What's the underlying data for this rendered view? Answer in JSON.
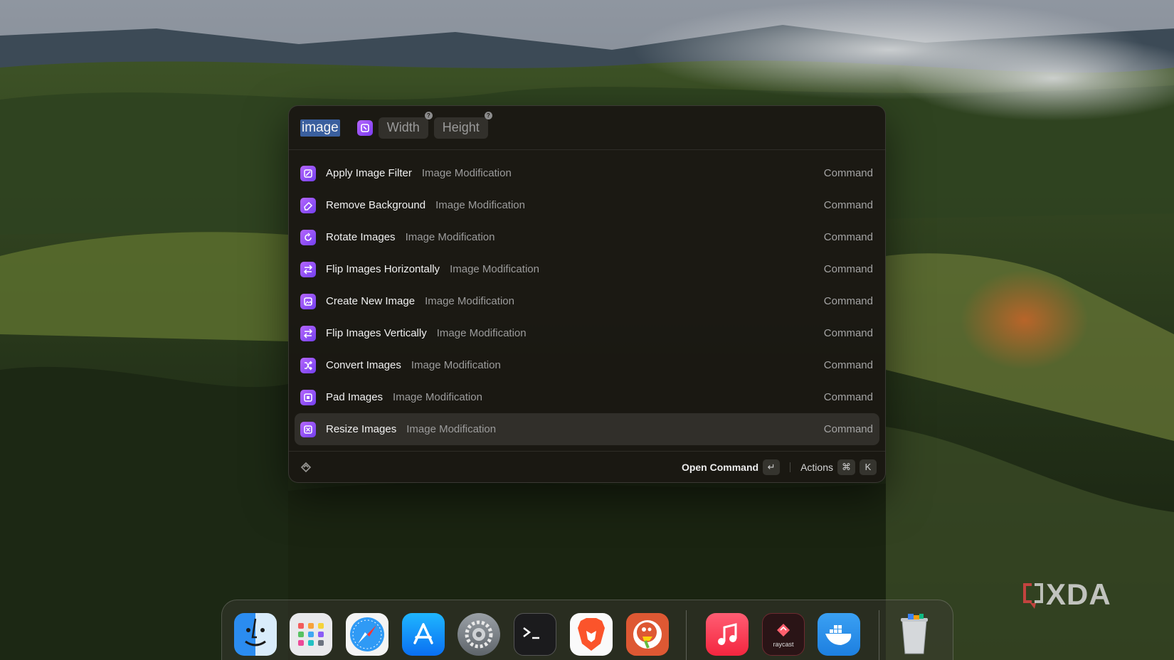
{
  "search": {
    "query": "image",
    "arguments": [
      {
        "placeholder": "Width",
        "help": "?"
      },
      {
        "placeholder": "Height",
        "help": "?"
      }
    ]
  },
  "results": [
    {
      "title": "Apply Image Filter",
      "subtitle": "Image Modification",
      "type": "Command",
      "icon": "filter-icon",
      "selected": false
    },
    {
      "title": "Remove Background",
      "subtitle": "Image Modification",
      "type": "Command",
      "icon": "eraser-icon",
      "selected": false
    },
    {
      "title": "Rotate Images",
      "subtitle": "Image Modification",
      "type": "Command",
      "icon": "rotate-icon",
      "selected": false
    },
    {
      "title": "Flip Images Horizontally",
      "subtitle": "Image Modification",
      "type": "Command",
      "icon": "flip-horizontal-icon",
      "selected": false
    },
    {
      "title": "Create New Image",
      "subtitle": "Image Modification",
      "type": "Command",
      "icon": "new-image-icon",
      "selected": false
    },
    {
      "title": "Flip Images Vertically",
      "subtitle": "Image Modification",
      "type": "Command",
      "icon": "flip-vertical-icon",
      "selected": false
    },
    {
      "title": "Convert Images",
      "subtitle": "Image Modification",
      "type": "Command",
      "icon": "shuffle-icon",
      "selected": false
    },
    {
      "title": "Pad Images",
      "subtitle": "Image Modification",
      "type": "Command",
      "icon": "pad-icon",
      "selected": false
    },
    {
      "title": "Resize Images",
      "subtitle": "Image Modification",
      "type": "Command",
      "icon": "resize-icon",
      "selected": true
    }
  ],
  "footer": {
    "primary_action": "Open Command",
    "primary_key": "↵",
    "actions_label": "Actions",
    "actions_keys": [
      "⌘",
      "K"
    ]
  },
  "dock": {
    "items": [
      "Finder",
      "Launchpad",
      "Safari",
      "App Store",
      "System Settings",
      "Terminal",
      "Brave",
      "DuckDuckGo",
      "Music",
      "Raycast",
      "Docker",
      "Trash"
    ],
    "raycast_label": "raycast"
  },
  "watermark": "XDA",
  "colors": {
    "accent_purple": "#9b4dff",
    "selection_highlight": "#3a5f9e",
    "panel_bg": "#1a1712"
  }
}
